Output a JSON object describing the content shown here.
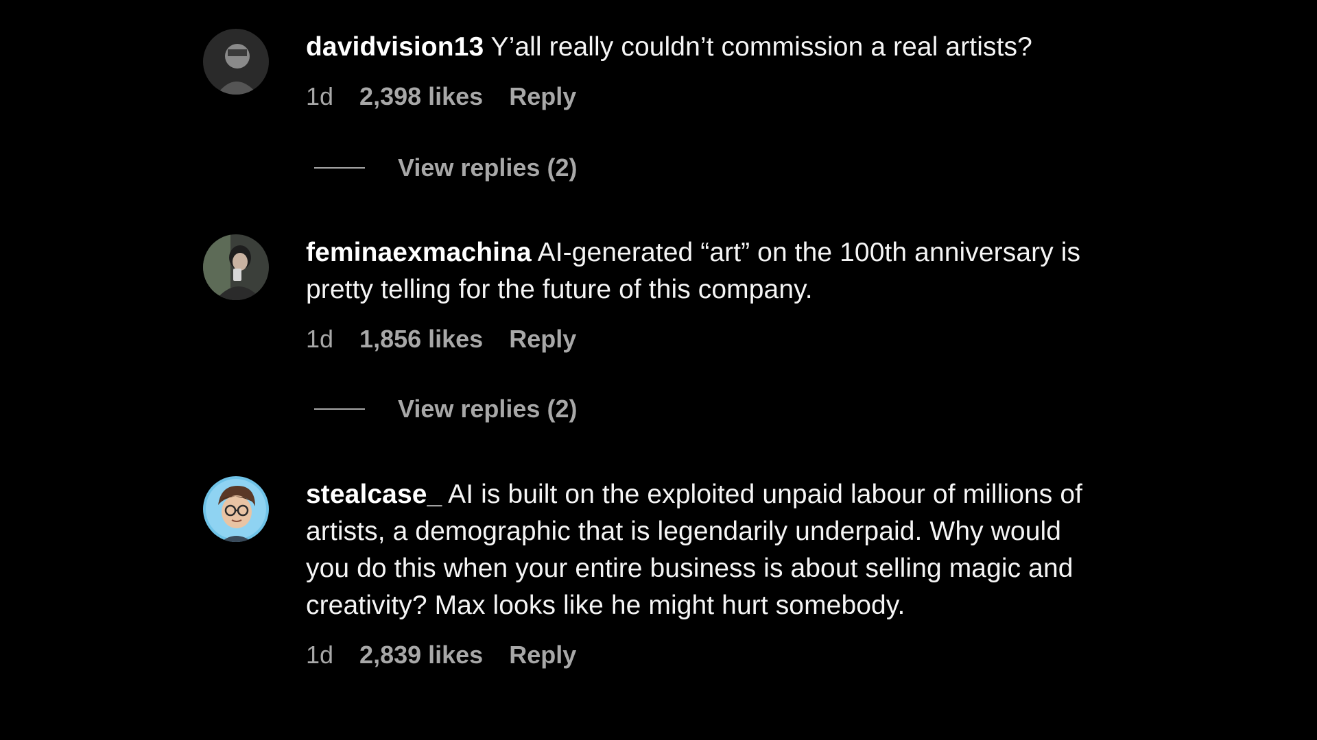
{
  "colors": {
    "background": "#000000",
    "primary_text": "#f5f5f5",
    "secondary_text": "#a8a8a8"
  },
  "comments": [
    {
      "username": "davidvision13",
      "text": "Y’all really couldn’t commission a real artists?",
      "time": "1d",
      "likes": "2,398 likes",
      "reply_label": "Reply",
      "view_replies": "View replies (2)"
    },
    {
      "username": "feminaexmachina",
      "text": "AI-generated “art” on the 100th anniversary is pretty telling for the future of this company.",
      "time": "1d",
      "likes": "1,856 likes",
      "reply_label": "Reply",
      "view_replies": "View replies (2)"
    },
    {
      "username": "stealcase_",
      "text": "AI is built on the exploited unpaid labour of millions of artists, a demographic that is legendarily underpaid. Why would you do this when your entire business is about selling magic and creativity? Max looks like he might hurt somebody.",
      "time": "1d",
      "likes": "2,839 likes",
      "reply_label": "Reply"
    }
  ]
}
